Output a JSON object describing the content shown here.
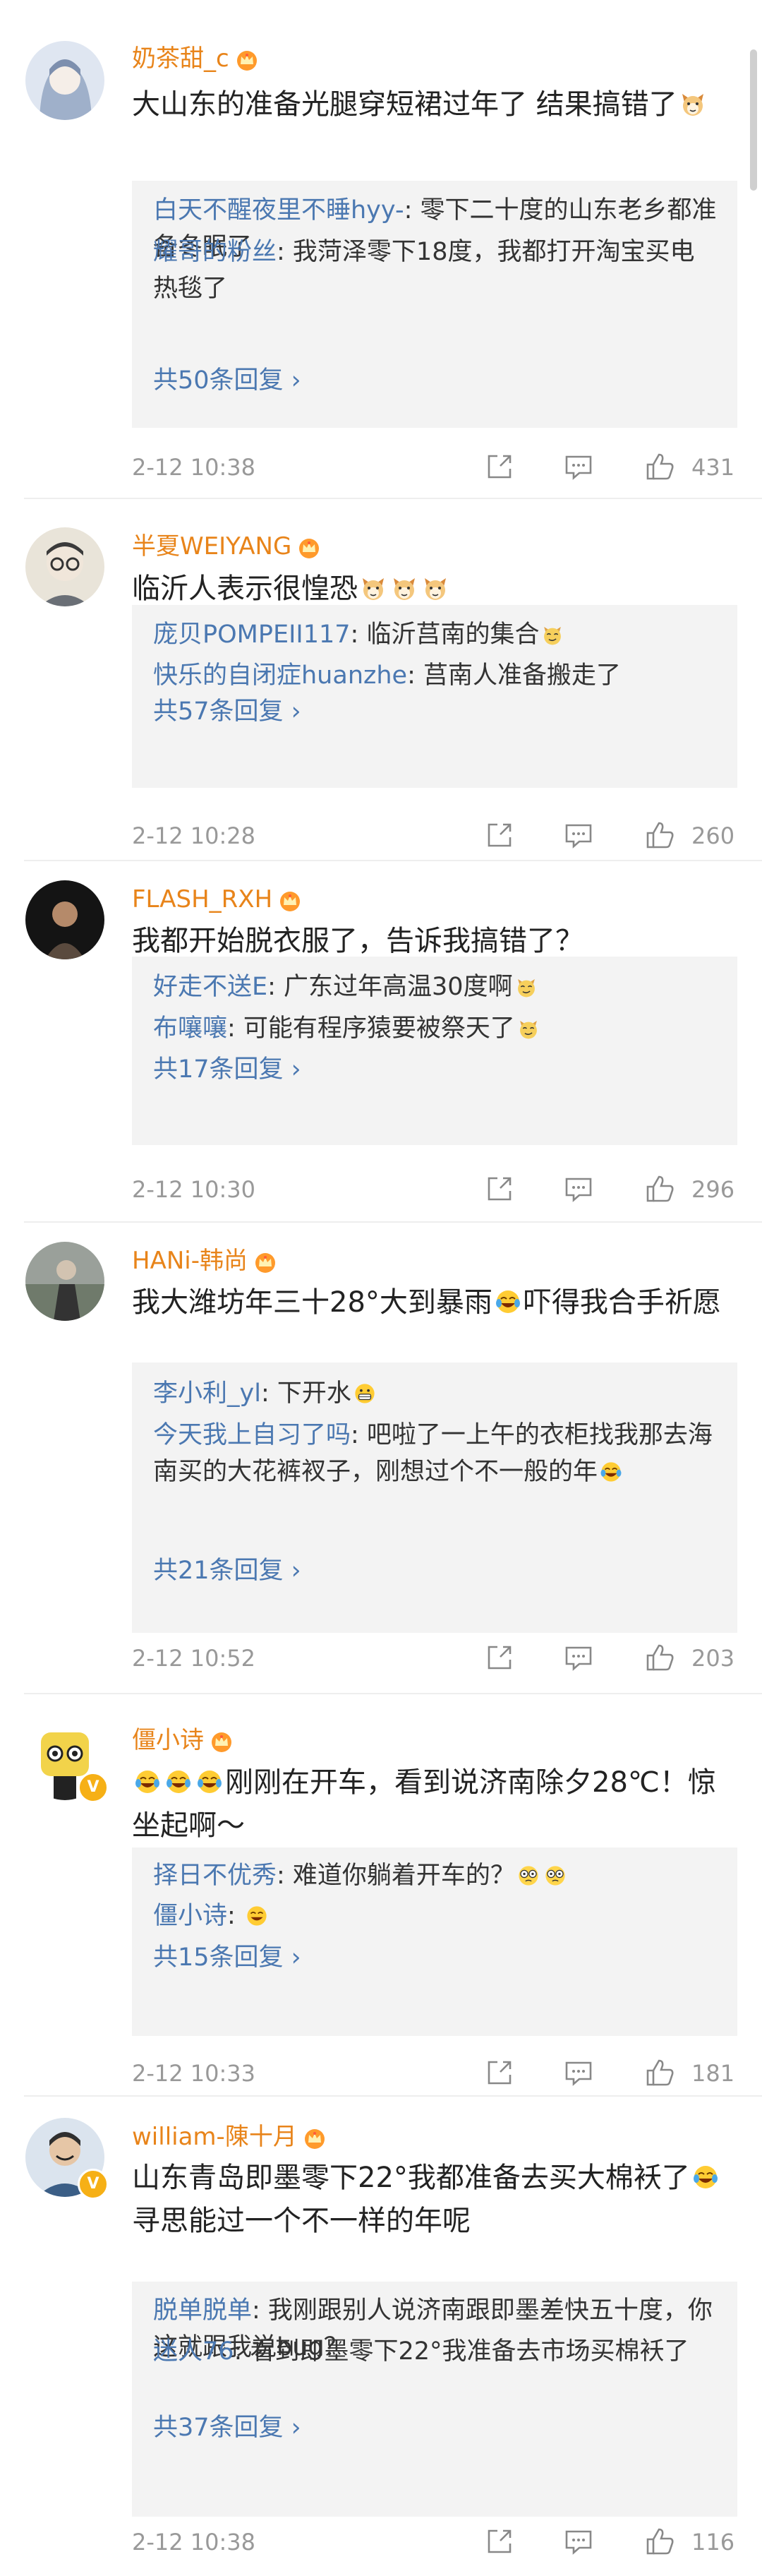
{
  "colors": {
    "username": "#e8841a",
    "reply_name": "#4b78b1",
    "meta": "#999999",
    "reply_bg": "#f3f3f3"
  },
  "comments": [
    {
      "username": "奶茶甜_c",
      "avatar_color": "#a8b7cf",
      "avatar_icon": "anime-girl-avatar",
      "parts": [
        {
          "t": "大山东的准备光腿穿短裙过年了 结果搞错了"
        },
        {
          "e": "cat-face-emoji"
        }
      ],
      "replies": [
        {
          "name": "白天不醒夜里不睡hyy-",
          "parts": [
            {
              "t": ": 零下二十度的山东老乡都准备冬眠了"
            }
          ]
        },
        {
          "name": "耀哥的粉丝",
          "parts": [
            {
              "t": ": 我菏泽零下18度，我都打开淘宝买电热毯了"
            }
          ]
        }
      ],
      "more": "共50条回复 ›",
      "time": "2-12 10:38",
      "likes": "431"
    },
    {
      "username": "半夏WEIYANG",
      "avatar_color": "#d9d0c2",
      "avatar_icon": "glasses-man-avatar",
      "parts": [
        {
          "t": "临沂人表示很惶恐"
        },
        {
          "e": "cat-face-emoji"
        },
        {
          "e": "cat-face-emoji"
        },
        {
          "e": "cat-face-emoji"
        }
      ],
      "replies": [
        {
          "name": "庞贝POMPEII117",
          "parts": [
            {
              "t": ": 临沂莒南的集合"
            },
            {
              "e": "sly-cat-emoji"
            }
          ]
        },
        {
          "name": "快乐的自闭症huanzhe",
          "parts": [
            {
              "t": ": 莒南人准备搬走了"
            }
          ]
        }
      ],
      "more": "共57条回复 ›",
      "time": "2-12 10:28",
      "likes": "260"
    },
    {
      "username": "FLASH_RXH",
      "avatar_color": "#1b1b1b",
      "avatar_icon": "dark-portrait-avatar",
      "parts": [
        {
          "t": "我都开始脱衣服了，告诉我搞错了？"
        }
      ],
      "replies": [
        {
          "name": "好走不送E",
          "parts": [
            {
              "t": ": 广东过年高温30度啊"
            },
            {
              "e": "sly-cat-emoji"
            }
          ]
        },
        {
          "name": "布嚷嚷",
          "parts": [
            {
              "t": ": 可能有程序猿要被祭天了"
            },
            {
              "e": "sly-cat-emoji"
            }
          ]
        }
      ],
      "more": "共17条回复 ›",
      "time": "2-12 10:30",
      "likes": "296"
    },
    {
      "username": "HANi-韩尚",
      "avatar_color": "#8a8f86",
      "avatar_icon": "outdoor-photo-avatar",
      "parts": [
        {
          "t": "我大潍坊年三十28°大到暴雨"
        },
        {
          "e": "laugh-cry-emoji"
        },
        {
          "t": "吓得我合手祈愿"
        }
      ],
      "replies": [
        {
          "name": "李小利_yl",
          "parts": [
            {
              "t": ": 下开水"
            },
            {
              "e": "grin-emoji"
            }
          ]
        },
        {
          "name": "今天我上自习了吗",
          "parts": [
            {
              "t": ": 吧啦了一上午的衣柜找我那去海南买的大花裤衩子，刚想过个不一般的年"
            },
            {
              "e": "laugh-cry-emoji"
            }
          ]
        }
      ],
      "more": "共21条回复 ›",
      "time": "2-12 10:52",
      "likes": "203"
    },
    {
      "username": "僵小诗",
      "avatar_color": "#2b2b2b",
      "avatar_icon": "cartoon-character-avatar",
      "verified": "V",
      "parts": [
        {
          "e": "laugh-cry-emoji"
        },
        {
          "e": "laugh-cry-emoji"
        },
        {
          "e": "laugh-cry-emoji"
        },
        {
          "t": "刚刚在开车，看到说济南除夕28℃！惊坐起啊～"
        }
      ],
      "replies": [
        {
          "name": "择日不优秀",
          "parts": [
            {
              "t": ": 难道你躺着开车的？"
            },
            {
              "e": "dizzy-face-emoji"
            },
            {
              "e": "dizzy-face-emoji"
            }
          ]
        },
        {
          "name": "僵小诗",
          "parts": [
            {
              "t": ": "
            },
            {
              "e": "laugh-emoji"
            }
          ]
        }
      ],
      "more": "共15条回复 ›",
      "time": "2-12 10:33",
      "likes": "181"
    },
    {
      "username": "william-陳十月",
      "avatar_color": "#5a7fa3",
      "avatar_icon": "smiling-man-avatar",
      "verified": "V",
      "parts": [
        {
          "t": "山东青岛即墨零下22°我都准备去买大棉袄了"
        },
        {
          "e": "laugh-cry-emoji"
        },
        {
          "t": "寻思能过一个不一样的年呢"
        }
      ],
      "replies": [
        {
          "name": "脱单脱单",
          "parts": [
            {
              "t": ": 我刚跟别人说济南跟即墨差快五十度，你这就跟我说bug？"
            }
          ]
        },
        {
          "name": "迷人76",
          "parts": [
            {
              "t": ": 看到即墨零下22°我准备去市场买棉袄了"
            }
          ]
        }
      ],
      "more": "共37条回复 ›",
      "time": "2-12 10:38",
      "likes": "116"
    }
  ]
}
